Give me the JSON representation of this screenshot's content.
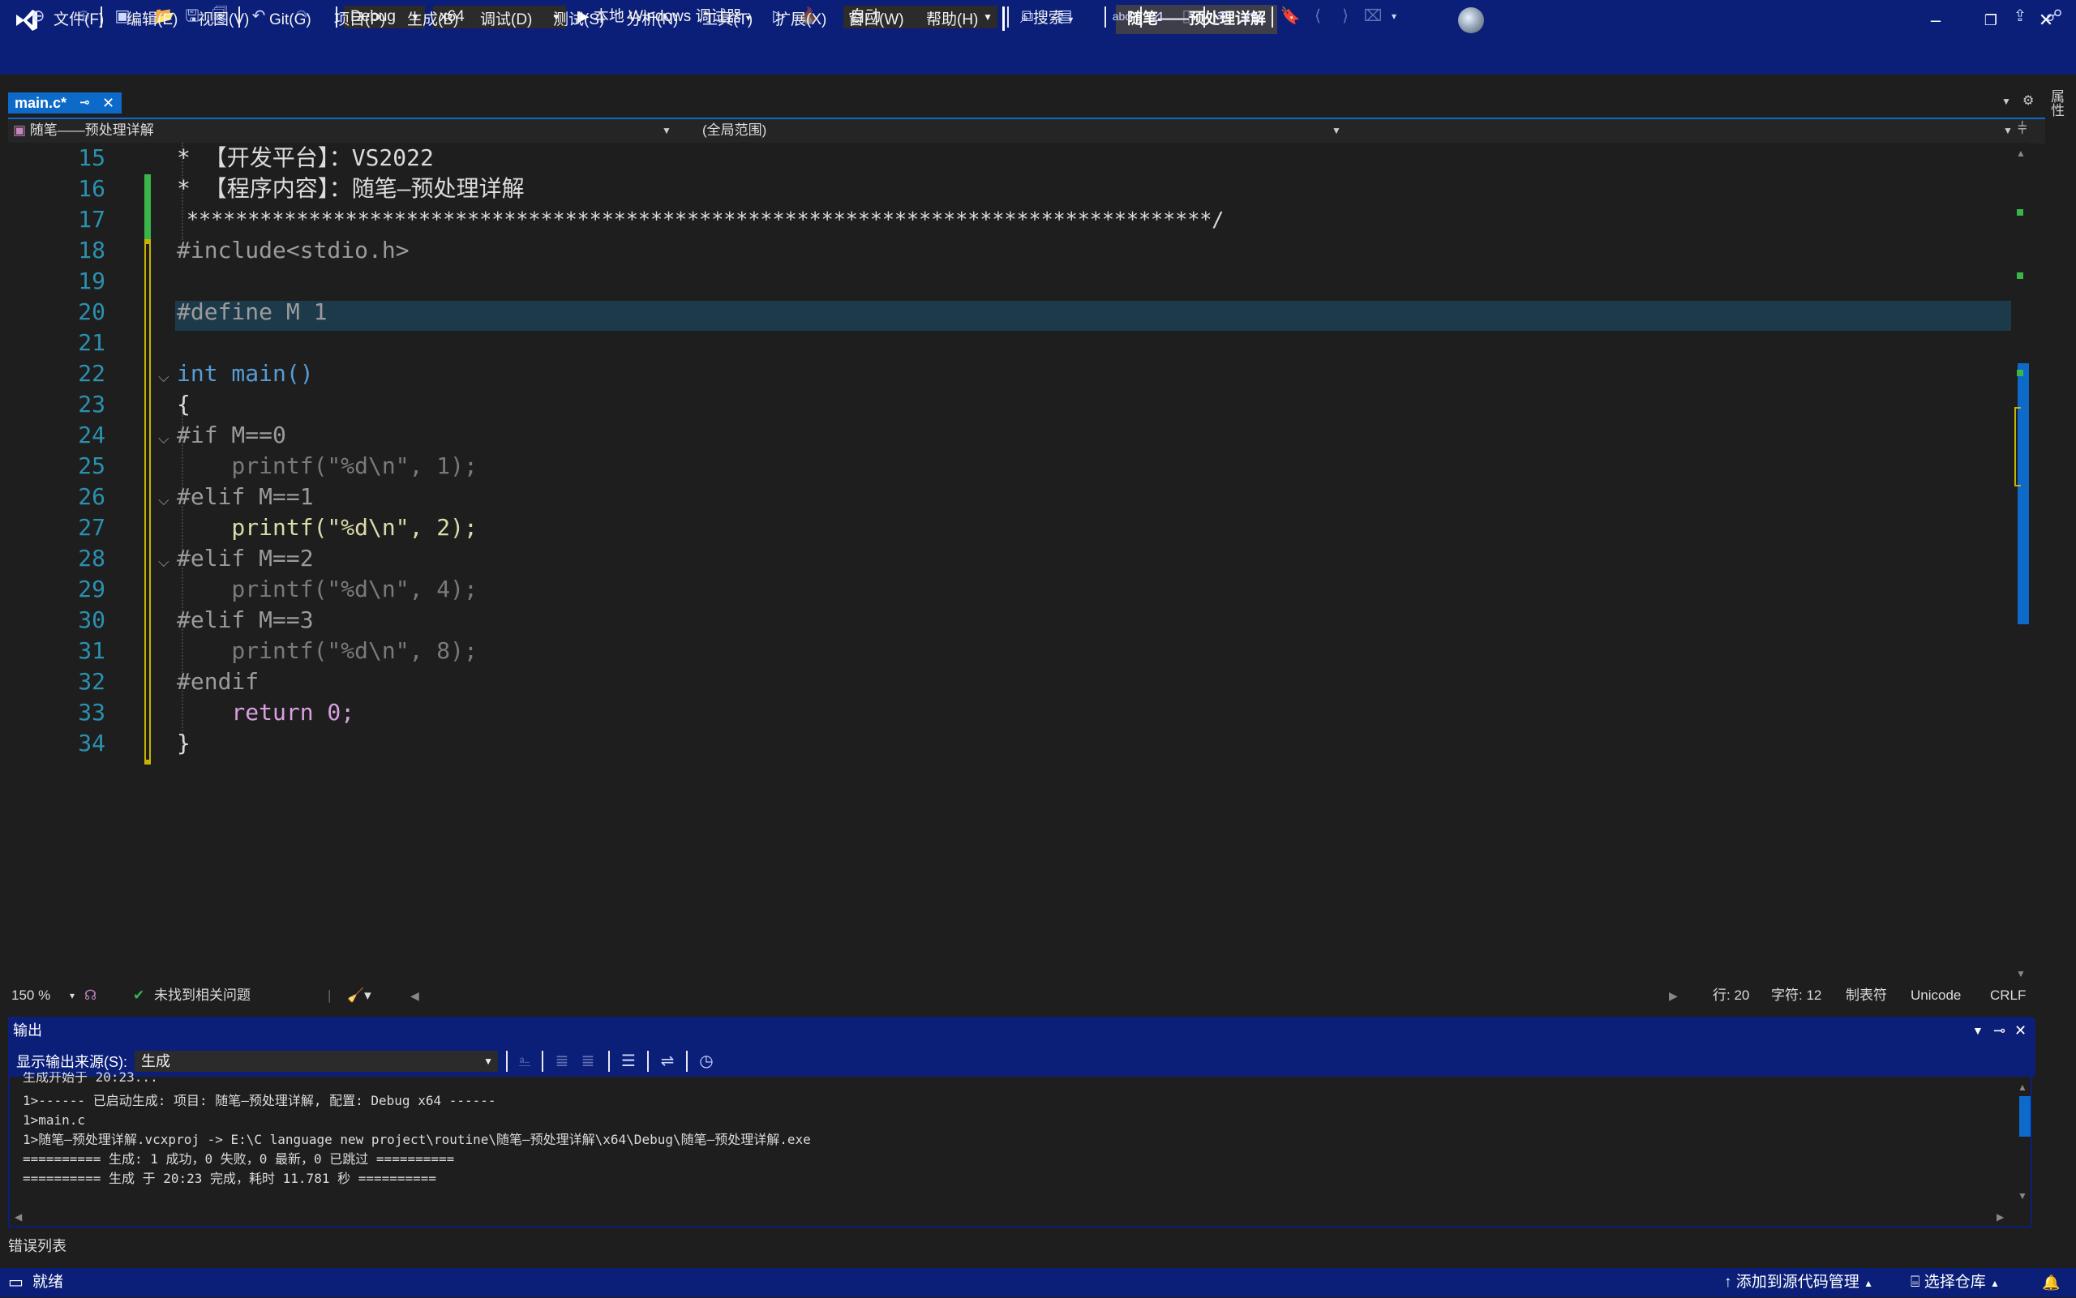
{
  "menu": [
    "文件(F)",
    "编辑(E)",
    "视图(V)",
    "Git(G)",
    "项目(P)",
    "生成(B)",
    "调试(D)",
    "测试(S)",
    "分析(N)",
    "工具(T)",
    "扩展(X)",
    "窗口(W)",
    "帮助(H)"
  ],
  "search_label": "搜索",
  "solution_name": "随笔——预处理详解",
  "toolbar": {
    "config": "Debug",
    "platform": "x64",
    "run_label": "本地 Windows 调试器",
    "auto_label": "自动"
  },
  "tab": {
    "title": "main.c*"
  },
  "navbar": {
    "project": "随笔——预处理详解",
    "scope": "(全局范围)",
    "member": ""
  },
  "code": {
    "lines": [
      {
        "n": "15",
        "text": "* 【开发平台】：VS2022"
      },
      {
        "n": "16",
        "text": "* 【程序内容】：随笔—预处理详解"
      },
      {
        "n": "17",
        "text": "************************************************************************************/"
      },
      {
        "n": "18",
        "text": "#include<stdio.h>"
      },
      {
        "n": "19",
        "text": ""
      },
      {
        "n": "20",
        "text": "#define M 1"
      },
      {
        "n": "21",
        "text": ""
      },
      {
        "n": "22",
        "text": "int main()"
      },
      {
        "n": "23",
        "text": "{"
      },
      {
        "n": "24",
        "text": "#if M==0"
      },
      {
        "n": "25",
        "text": "    printf(\"%d\\n\", 1);"
      },
      {
        "n": "26",
        "text": "#elif M==1"
      },
      {
        "n": "27",
        "text": "    printf(\"%d\\n\", 2);"
      },
      {
        "n": "28",
        "text": "#elif M==2"
      },
      {
        "n": "29",
        "text": "    printf(\"%d\\n\", 4);"
      },
      {
        "n": "30",
        "text": "#elif M==3"
      },
      {
        "n": "31",
        "text": "    printf(\"%d\\n\", 8);"
      },
      {
        "n": "32",
        "text": "#endif"
      },
      {
        "n": "33",
        "text": "    return 0;"
      },
      {
        "n": "34",
        "text": "}"
      }
    ]
  },
  "editor_status": {
    "zoom": "150 %",
    "issues": "未找到相关问题",
    "line": "行: 20",
    "col": "字符: 12",
    "tabs": "制表符",
    "encoding": "Unicode",
    "eol": "CRLF"
  },
  "output": {
    "title": "输出",
    "source_label": "显示输出来源(S):",
    "source_value": "生成",
    "lines": [
      "生成开始于 20:23...",
      "1>------ 已启动生成: 项目: 随笔—预处理详解, 配置: Debug x64 ------",
      "1>main.c",
      "1>随笔—预处理详解.vcxproj -> E:\\C language new project\\routine\\随笔—预处理详解\\x64\\Debug\\随笔—预处理详解.exe",
      "========== 生成: 1 成功，0 失败，0 最新，0 已跳过 ==========",
      "========== 生成 于 20:23 完成，耗时 11.781 秒 =========="
    ]
  },
  "error_list": "错误列表",
  "statusbar": {
    "ready": "就绪",
    "source_control": "添加到源代码管理",
    "repo": "选择仓库"
  },
  "side_tab": "属性",
  "colors": {
    "chrome": "#0b1f78",
    "accent": "#0e6ac8",
    "editor_bg": "#1e1e1e",
    "line_number": "#2b91af",
    "change_saved": "#3bb54a",
    "change_unsaved": "#c8b400"
  }
}
